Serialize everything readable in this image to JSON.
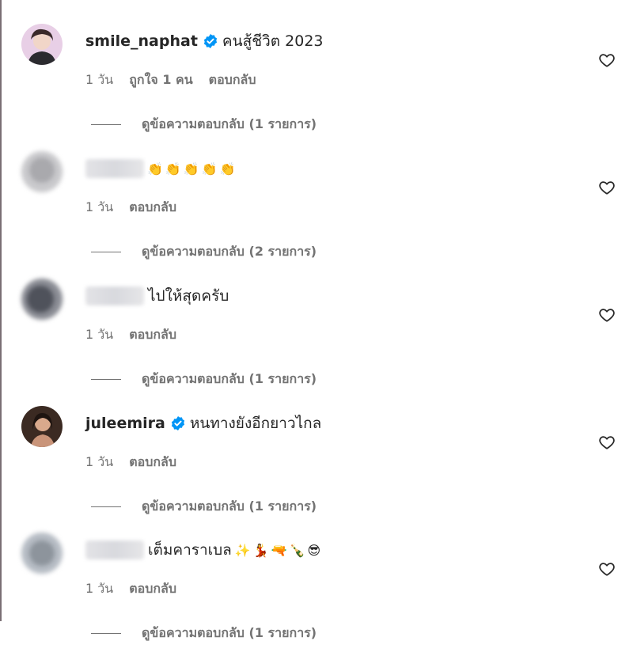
{
  "comments": [
    {
      "username": "smile_naphat",
      "verified": true,
      "text": "คนสู้ชีวิต 2023",
      "time": "1 วัน",
      "likes": "ถูกใจ 1 คน",
      "reply_label": "ตอบกลับ",
      "view_replies": "ดูข้อความตอบกลับ (1 รายการ)",
      "avatar_blurred": false,
      "name_blurred": false
    },
    {
      "username": "",
      "verified": false,
      "text": "",
      "emojis": [
        "👏",
        "👏",
        "👏",
        "👏",
        "👏"
      ],
      "time": "1 วัน",
      "reply_label": "ตอบกลับ",
      "view_replies": "ดูข้อความตอบกลับ (2 รายการ)",
      "avatar_blurred": true,
      "name_blurred": true
    },
    {
      "username": "",
      "verified": false,
      "text": "ไปให้สุดครับ",
      "time": "1 วัน",
      "reply_label": "ตอบกลับ",
      "view_replies": "ดูข้อความตอบกลับ (1 รายการ)",
      "avatar_blurred": true,
      "name_blurred": true
    },
    {
      "username": "juleemira",
      "verified": true,
      "text": "หนทางยังอีกยาวไกล",
      "time": "1 วัน",
      "reply_label": "ตอบกลับ",
      "view_replies": "ดูข้อความตอบกลับ (1 รายการ)",
      "avatar_blurred": false,
      "name_blurred": false
    },
    {
      "username": "",
      "verified": false,
      "text": "เต็มคาราเบล",
      "emojis": [
        "✨",
        "💃",
        "🔫",
        "🍾",
        "😎"
      ],
      "time": "1 วัน",
      "reply_label": "ตอบกลับ",
      "view_replies": "ดูข้อความตอบกลับ (1 รายการ)",
      "avatar_blurred": true,
      "name_blurred": true
    }
  ],
  "icons": {
    "verified": "verified-badge-icon",
    "like": "heart-outline-icon"
  },
  "colors": {
    "verified_blue": "#0095f6",
    "secondary_text": "#737373",
    "primary_text": "#262626"
  }
}
